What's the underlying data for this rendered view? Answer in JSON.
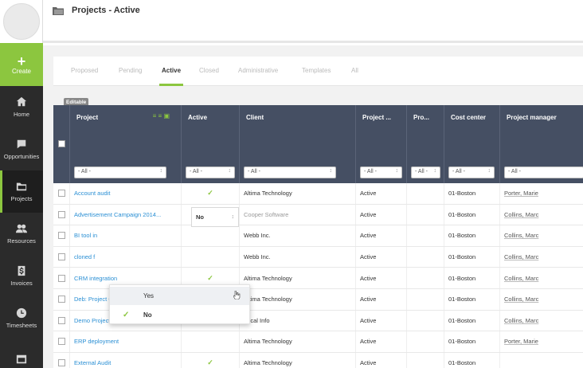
{
  "sidebar": {
    "create_label": "Create",
    "items": [
      {
        "label": "Home",
        "icon": "home-icon"
      },
      {
        "label": "Opportunities",
        "icon": "chat-icon"
      },
      {
        "label": "Projects",
        "icon": "folder-icon",
        "active": true
      },
      {
        "label": "Resources",
        "icon": "people-icon"
      },
      {
        "label": "Invoices",
        "icon": "dollar-icon"
      },
      {
        "label": "Timesheets",
        "icon": "clock-icon"
      },
      {
        "label": "",
        "icon": "calendar-icon"
      }
    ]
  },
  "header": {
    "title": "Projects - Active"
  },
  "tabs": [
    "Proposed",
    "Pending",
    "Active",
    "Closed",
    "Administrative",
    "Templates",
    "All"
  ],
  "active_tab": "Active",
  "editable_badge": "Editable",
  "columns": [
    "Project",
    "Active",
    "Client",
    "Project ...",
    "Pro...",
    "Cost center",
    "Project manager"
  ],
  "filter_all": "- All -",
  "rows": [
    {
      "project": "Account audit",
      "active": "✓",
      "client": "Altima Technology",
      "status": "Active",
      "cost": "01-Boston",
      "manager": "Porter, Marie"
    },
    {
      "project": "Advertisement Campaign 2014...",
      "active": "No",
      "client": "Cooper Software",
      "status": "Active",
      "cost": "01-Boston",
      "manager": "Collins, Marc"
    },
    {
      "project": "BI tool in",
      "active": "",
      "client": "Webb Inc.",
      "status": "Active",
      "cost": "01-Boston",
      "manager": "Collins, Marc"
    },
    {
      "project": "cloned f",
      "active": "",
      "client": "Webb Inc.",
      "status": "Active",
      "cost": "01-Boston",
      "manager": "Collins, Marc"
    },
    {
      "project": "CRM integration",
      "active": "✓",
      "client": "Altima Technology",
      "status": "Active",
      "cost": "01-Boston",
      "manager": "Collins, Marc"
    },
    {
      "project": "Deb: Project Center",
      "active": "✓",
      "client": "Altima Technology",
      "status": "Active",
      "cost": "01-Boston",
      "manager": "Collins, Marc"
    },
    {
      "project": "Demo Project",
      "active": "✓",
      "client": "Local Info",
      "status": "Active",
      "cost": "01-Boston",
      "manager": "Collins, Marc"
    },
    {
      "project": "ERP deployment",
      "active": "",
      "client": "Altima Technology",
      "status": "Active",
      "cost": "01-Boston",
      "manager": "Porter, Marie"
    },
    {
      "project": "External Audit",
      "active": "✓",
      "client": "Altima Technology",
      "status": "Active",
      "cost": "01-Boston",
      "manager": ""
    }
  ],
  "dropdown": {
    "options": [
      "Yes",
      "No"
    ],
    "selected": "No",
    "hovered": "Yes"
  },
  "colors": {
    "accent": "#8cc63f",
    "header_bg": "#454f63",
    "link": "#2a8fd4",
    "sidebar": "#2b2b2b"
  }
}
